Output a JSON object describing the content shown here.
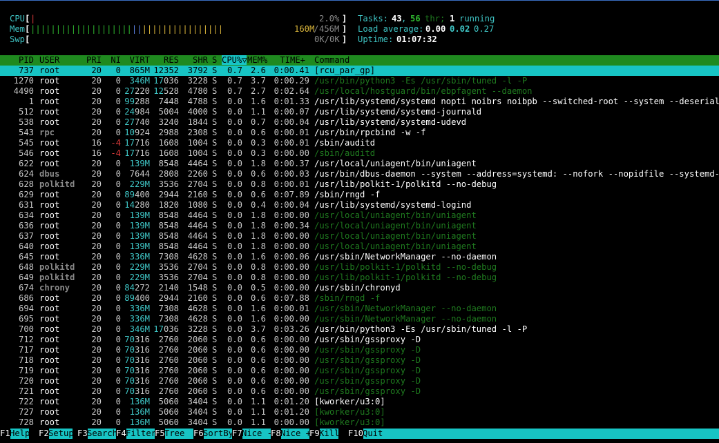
{
  "meters": {
    "cpu": {
      "label": "CPU",
      "value": "2.0%"
    },
    "mem": {
      "label": "Mem",
      "used": "160M",
      "total": "456M",
      "fraction": 0.35
    },
    "swp": {
      "label": "Swp",
      "value": "0K/0K"
    }
  },
  "summary": {
    "tasks_label": "Tasks:",
    "tasks": "43",
    "sep": ",",
    "threads": "56",
    "thr_label": "thr;",
    "running": "1",
    "running_label": "running",
    "load_label": "Load average:",
    "load1": "0.00",
    "load5": "0.02",
    "load15": "0.27",
    "uptime_label": "Uptime:",
    "uptime": "01:07:32"
  },
  "columns": {
    "pid": "PID",
    "user": "USER",
    "pri": "PRI",
    "ni": "NI",
    "virt": "VIRT",
    "res": "RES",
    "shr": "SHR",
    "s": "S",
    "cpu": "CPU%▽",
    "mem": "MEM%",
    "time": "TIME+",
    "command": "Command"
  },
  "processes": [
    {
      "pid": "737",
      "user": "root",
      "pri": "20",
      "ni": "0",
      "virt": "865M",
      "res": "12352",
      "shr": "3792",
      "s": "S",
      "cpu": "0.7",
      "mem": "2.6",
      "time": "0:00.41",
      "command": "[rcu_par_gp]",
      "thread": false,
      "selected": true
    },
    {
      "pid": "1270",
      "user": "root",
      "pri": "20",
      "ni": "0",
      "virt": "346M",
      "res": "17036",
      "shr": "3228",
      "s": "S",
      "cpu": "0.7",
      "mem": "3.7",
      "time": "0:00.29",
      "command": "/usr/bin/python3 -Es /usr/sbin/tuned -l -P",
      "thread": true
    },
    {
      "pid": "4490",
      "user": "root",
      "pri": "20",
      "ni": "0",
      "virt": "27220",
      "res": "12528",
      "shr": "4780",
      "s": "S",
      "cpu": "0.7",
      "mem": "2.7",
      "time": "0:02.64",
      "command": "/usr/local/hostguard/bin/ebpfagent --daemon",
      "thread": true
    },
    {
      "pid": "1",
      "user": "root",
      "pri": "20",
      "ni": "0",
      "virt": "99288",
      "res": "7448",
      "shr": "4788",
      "s": "S",
      "cpu": "0.0",
      "mem": "1.6",
      "time": "0:01.33",
      "command": "/usr/lib/systemd/systemd nopti noibrs noibpb --switched-root --system --deserialize",
      "thread": false
    },
    {
      "pid": "512",
      "user": "root",
      "pri": "20",
      "ni": "0",
      "virt": "24984",
      "res": "5004",
      "shr": "4000",
      "s": "S",
      "cpu": "0.0",
      "mem": "1.1",
      "time": "0:00.07",
      "command": "/usr/lib/systemd/systemd-journald",
      "thread": false
    },
    {
      "pid": "538",
      "user": "root",
      "pri": "20",
      "ni": "0",
      "virt": "27740",
      "res": "3240",
      "shr": "1844",
      "s": "S",
      "cpu": "0.0",
      "mem": "0.7",
      "time": "0:00.04",
      "command": "/usr/lib/systemd/systemd-udevd",
      "thread": false
    },
    {
      "pid": "543",
      "user": "rpc",
      "pri": "20",
      "ni": "0",
      "virt": "10924",
      "res": "2988",
      "shr": "2308",
      "s": "S",
      "cpu": "0.0",
      "mem": "0.6",
      "time": "0:00.01",
      "command": "/usr/bin/rpcbind -w -f",
      "thread": false
    },
    {
      "pid": "545",
      "user": "root",
      "pri": "16",
      "ni": "-4",
      "virt": "17716",
      "res": "1608",
      "shr": "1004",
      "s": "S",
      "cpu": "0.0",
      "mem": "0.3",
      "time": "0:00.01",
      "command": "/sbin/auditd",
      "thread": false
    },
    {
      "pid": "546",
      "user": "root",
      "pri": "16",
      "ni": "-4",
      "virt": "17716",
      "res": "1608",
      "shr": "1004",
      "s": "S",
      "cpu": "0.0",
      "mem": "0.3",
      "time": "0:00.00",
      "command": "/sbin/auditd",
      "thread": true
    },
    {
      "pid": "622",
      "user": "root",
      "pri": "20",
      "ni": "0",
      "virt": "139M",
      "res": "8548",
      "shr": "4464",
      "s": "S",
      "cpu": "0.0",
      "mem": "1.8",
      "time": "0:00.37",
      "command": "/usr/local/uniagent/bin/uniagent",
      "thread": false
    },
    {
      "pid": "624",
      "user": "dbus",
      "pri": "20",
      "ni": "0",
      "virt": "7644",
      "res": "2808",
      "shr": "2260",
      "s": "S",
      "cpu": "0.0",
      "mem": "0.6",
      "time": "0:00.03",
      "command": "/usr/bin/dbus-daemon --system --address=systemd: --nofork --nopidfile --systemd-act",
      "thread": false
    },
    {
      "pid": "628",
      "user": "polkitd",
      "pri": "20",
      "ni": "0",
      "virt": "229M",
      "res": "3536",
      "shr": "2704",
      "s": "S",
      "cpu": "0.0",
      "mem": "0.8",
      "time": "0:00.01",
      "command": "/usr/lib/polkit-1/polkitd --no-debug",
      "thread": false
    },
    {
      "pid": "629",
      "user": "root",
      "pri": "20",
      "ni": "0",
      "virt": "89400",
      "res": "2944",
      "shr": "2160",
      "s": "S",
      "cpu": "0.0",
      "mem": "0.6",
      "time": "0:07.89",
      "command": "/sbin/rngd -f",
      "thread": false
    },
    {
      "pid": "631",
      "user": "root",
      "pri": "20",
      "ni": "0",
      "virt": "14280",
      "res": "1820",
      "shr": "1080",
      "s": "S",
      "cpu": "0.0",
      "mem": "0.4",
      "time": "0:00.04",
      "command": "/usr/lib/systemd/systemd-logind",
      "thread": false
    },
    {
      "pid": "634",
      "user": "root",
      "pri": "20",
      "ni": "0",
      "virt": "139M",
      "res": "8548",
      "shr": "4464",
      "s": "S",
      "cpu": "0.0",
      "mem": "1.8",
      "time": "0:00.00",
      "command": "/usr/local/uniagent/bin/uniagent",
      "thread": true
    },
    {
      "pid": "636",
      "user": "root",
      "pri": "20",
      "ni": "0",
      "virt": "139M",
      "res": "8548",
      "shr": "4464",
      "s": "S",
      "cpu": "0.0",
      "mem": "1.8",
      "time": "0:00.34",
      "command": "/usr/local/uniagent/bin/uniagent",
      "thread": true
    },
    {
      "pid": "637",
      "user": "root",
      "pri": "20",
      "ni": "0",
      "virt": "139M",
      "res": "8548",
      "shr": "4464",
      "s": "S",
      "cpu": "0.0",
      "mem": "1.8",
      "time": "0:00.00",
      "command": "/usr/local/uniagent/bin/uniagent",
      "thread": true
    },
    {
      "pid": "640",
      "user": "root",
      "pri": "20",
      "ni": "0",
      "virt": "139M",
      "res": "8548",
      "shr": "4464",
      "s": "S",
      "cpu": "0.0",
      "mem": "1.8",
      "time": "0:00.00",
      "command": "/usr/local/uniagent/bin/uniagent",
      "thread": true
    },
    {
      "pid": "645",
      "user": "root",
      "pri": "20",
      "ni": "0",
      "virt": "336M",
      "res": "7308",
      "shr": "4628",
      "s": "S",
      "cpu": "0.0",
      "mem": "1.6",
      "time": "0:00.06",
      "command": "/usr/sbin/NetworkManager --no-daemon",
      "thread": false
    },
    {
      "pid": "648",
      "user": "polkitd",
      "pri": "20",
      "ni": "0",
      "virt": "229M",
      "res": "3536",
      "shr": "2704",
      "s": "S",
      "cpu": "0.0",
      "mem": "0.8",
      "time": "0:00.00",
      "command": "/usr/lib/polkit-1/polkitd --no-debug",
      "thread": true
    },
    {
      "pid": "649",
      "user": "polkitd",
      "pri": "20",
      "ni": "0",
      "virt": "229M",
      "res": "3536",
      "shr": "2704",
      "s": "S",
      "cpu": "0.0",
      "mem": "0.8",
      "time": "0:00.00",
      "command": "/usr/lib/polkit-1/polkitd --no-debug",
      "thread": true
    },
    {
      "pid": "674",
      "user": "chrony",
      "pri": "20",
      "ni": "0",
      "virt": "84272",
      "res": "2140",
      "shr": "1548",
      "s": "S",
      "cpu": "0.0",
      "mem": "0.5",
      "time": "0:00.00",
      "command": "/usr/sbin/chronyd",
      "thread": false
    },
    {
      "pid": "686",
      "user": "root",
      "pri": "20",
      "ni": "0",
      "virt": "89400",
      "res": "2944",
      "shr": "2160",
      "s": "S",
      "cpu": "0.0",
      "mem": "0.6",
      "time": "0:07.88",
      "command": "/sbin/rngd -f",
      "thread": true
    },
    {
      "pid": "694",
      "user": "root",
      "pri": "20",
      "ni": "0",
      "virt": "336M",
      "res": "7308",
      "shr": "4628",
      "s": "S",
      "cpu": "0.0",
      "mem": "1.6",
      "time": "0:00.01",
      "command": "/usr/sbin/NetworkManager --no-daemon",
      "thread": true
    },
    {
      "pid": "695",
      "user": "root",
      "pri": "20",
      "ni": "0",
      "virt": "336M",
      "res": "7308",
      "shr": "4628",
      "s": "S",
      "cpu": "0.0",
      "mem": "1.6",
      "time": "0:00.00",
      "command": "/usr/sbin/NetworkManager --no-daemon",
      "thread": true
    },
    {
      "pid": "700",
      "user": "root",
      "pri": "20",
      "ni": "0",
      "virt": "346M",
      "res": "17036",
      "shr": "3228",
      "s": "S",
      "cpu": "0.0",
      "mem": "3.7",
      "time": "0:03.26",
      "command": "/usr/bin/python3 -Es /usr/sbin/tuned -l -P",
      "thread": false
    },
    {
      "pid": "712",
      "user": "root",
      "pri": "20",
      "ni": "0",
      "virt": "70316",
      "res": "2760",
      "shr": "2060",
      "s": "S",
      "cpu": "0.0",
      "mem": "0.6",
      "time": "0:00.00",
      "command": "/usr/sbin/gssproxy -D",
      "thread": false
    },
    {
      "pid": "717",
      "user": "root",
      "pri": "20",
      "ni": "0",
      "virt": "70316",
      "res": "2760",
      "shr": "2060",
      "s": "S",
      "cpu": "0.0",
      "mem": "0.6",
      "time": "0:00.00",
      "command": "/usr/sbin/gssproxy -D",
      "thread": true
    },
    {
      "pid": "718",
      "user": "root",
      "pri": "20",
      "ni": "0",
      "virt": "70316",
      "res": "2760",
      "shr": "2060",
      "s": "S",
      "cpu": "0.0",
      "mem": "0.6",
      "time": "0:00.00",
      "command": "/usr/sbin/gssproxy -D",
      "thread": true
    },
    {
      "pid": "719",
      "user": "root",
      "pri": "20",
      "ni": "0",
      "virt": "70316",
      "res": "2760",
      "shr": "2060",
      "s": "S",
      "cpu": "0.0",
      "mem": "0.6",
      "time": "0:00.00",
      "command": "/usr/sbin/gssproxy -D",
      "thread": true
    },
    {
      "pid": "720",
      "user": "root",
      "pri": "20",
      "ni": "0",
      "virt": "70316",
      "res": "2760",
      "shr": "2060",
      "s": "S",
      "cpu": "0.0",
      "mem": "0.6",
      "time": "0:00.00",
      "command": "/usr/sbin/gssproxy -D",
      "thread": true
    },
    {
      "pid": "721",
      "user": "root",
      "pri": "20",
      "ni": "0",
      "virt": "70316",
      "res": "2760",
      "shr": "2060",
      "s": "S",
      "cpu": "0.0",
      "mem": "0.6",
      "time": "0:00.00",
      "command": "/usr/sbin/gssproxy -D",
      "thread": true
    },
    {
      "pid": "722",
      "user": "root",
      "pri": "20",
      "ni": "0",
      "virt": "136M",
      "res": "5060",
      "shr": "3404",
      "s": "S",
      "cpu": "0.0",
      "mem": "1.1",
      "time": "0:01.20",
      "command": "[kworker/u3:0]",
      "thread": false
    },
    {
      "pid": "727",
      "user": "root",
      "pri": "20",
      "ni": "0",
      "virt": "136M",
      "res": "5060",
      "shr": "3404",
      "s": "S",
      "cpu": "0.0",
      "mem": "1.1",
      "time": "0:01.20",
      "command": "[kworker/u3:0]",
      "thread": true
    },
    {
      "pid": "728",
      "user": "root",
      "pri": "20",
      "ni": "0",
      "virt": "136M",
      "res": "5060",
      "shr": "3404",
      "s": "S",
      "cpu": "0.0",
      "mem": "1.1",
      "time": "0:00.00",
      "command": "[kworker/u3:0]",
      "thread": true
    }
  ],
  "function_keys": [
    {
      "key": "F1",
      "label": "Help"
    },
    {
      "key": "F2",
      "label": "Setup"
    },
    {
      "key": "F3",
      "label": "Search"
    },
    {
      "key": "F4",
      "label": "Filter"
    },
    {
      "key": "F5",
      "label": "Tree"
    },
    {
      "key": "F6",
      "label": "SortBy"
    },
    {
      "key": "F7",
      "label": "Nice -"
    },
    {
      "key": "F8",
      "label": "Nice +"
    },
    {
      "key": "F9",
      "label": "Kill"
    },
    {
      "key": "F10",
      "label": "Quit"
    }
  ],
  "colors": {
    "header_bg": "#1f8a1f",
    "selection_bg": "#17c4c4",
    "thread_fg": "#1f7a1f"
  }
}
